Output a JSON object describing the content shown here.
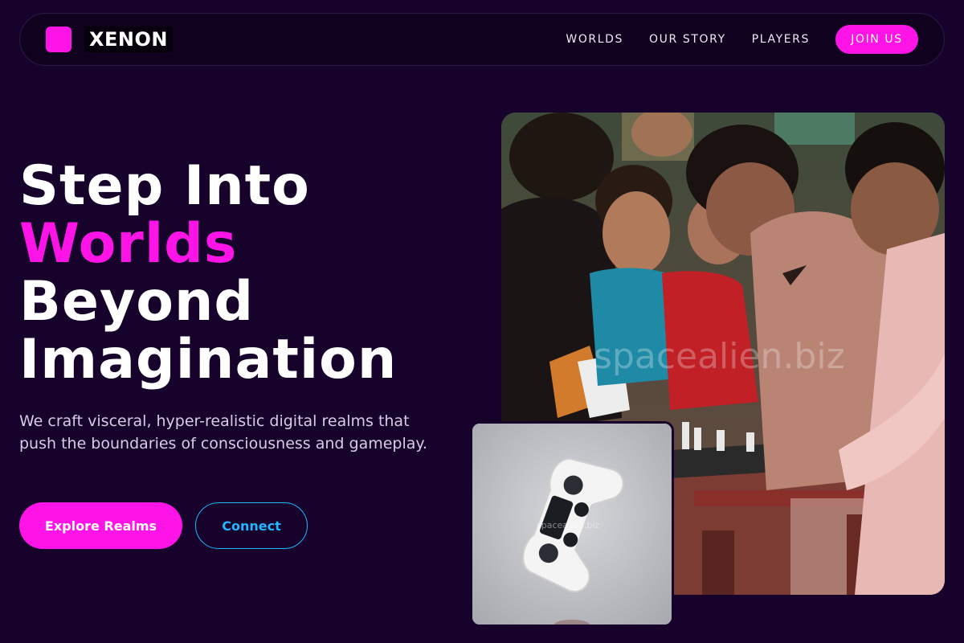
{
  "brand": {
    "name": "XENON",
    "logo_color": "#ff14e8"
  },
  "nav": {
    "links": [
      "WORLDS",
      "OUR STORY",
      "PLAYERS"
    ],
    "cta_label": "JOIN US"
  },
  "hero": {
    "title_line1": "Step Into",
    "title_accent": "Worlds",
    "title_line3": "Beyond",
    "title_line4": "Imagination",
    "description": "We craft visceral, hyper-realistic digital realms that push the boundaries of consciousness and gameplay.",
    "primary_button": "Explore Realms",
    "secondary_button": "Connect"
  },
  "images": {
    "main_photo_icon": "photo-children-playing-chess",
    "inset_photo_icon": "photo-game-controller",
    "main_watermark": "spacealien.biz",
    "inset_watermark": "spacealien.biz"
  },
  "colors": {
    "background": "#16022b",
    "accent": "#ff14e8",
    "secondary": "#22b6ff"
  }
}
